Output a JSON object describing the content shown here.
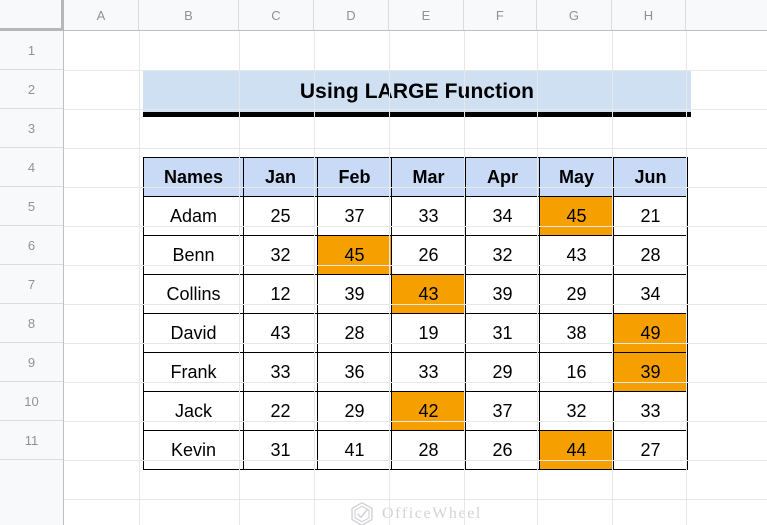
{
  "spreadsheet": {
    "column_headers": [
      "A",
      "B",
      "C",
      "D",
      "E",
      "F",
      "G",
      "H"
    ],
    "row_headers": [
      "1",
      "2",
      "3",
      "4",
      "5",
      "6",
      "7",
      "8",
      "9",
      "10",
      "11"
    ]
  },
  "title": {
    "text": "Using LARGE Function",
    "background_color": "#cfe0f2",
    "underline_color": "#000000"
  },
  "table": {
    "headers": [
      "Names",
      "Jan",
      "Feb",
      "Mar",
      "Apr",
      "May",
      "Jun"
    ],
    "header_background": "#c9daf6",
    "highlight_color": "#f5a000",
    "rows": [
      {
        "name": "Adam",
        "values": [
          "25",
          "37",
          "33",
          "34",
          "45",
          "21"
        ],
        "highlight": 4
      },
      {
        "name": "Benn",
        "values": [
          "32",
          "45",
          "26",
          "32",
          "43",
          "28"
        ],
        "highlight": 1
      },
      {
        "name": "Collins",
        "values": [
          "12",
          "39",
          "43",
          "39",
          "29",
          "34"
        ],
        "highlight": 2
      },
      {
        "name": "David",
        "values": [
          "43",
          "28",
          "19",
          "31",
          "38",
          "49"
        ],
        "highlight": 5
      },
      {
        "name": "Frank",
        "values": [
          "33",
          "36",
          "33",
          "29",
          "16",
          "39"
        ],
        "highlight": 5
      },
      {
        "name": "Jack",
        "values": [
          "22",
          "29",
          "42",
          "37",
          "32",
          "33"
        ],
        "highlight": 2
      },
      {
        "name": "Kevin",
        "values": [
          "31",
          "41",
          "28",
          "26",
          "44",
          "27"
        ],
        "highlight": 4
      }
    ]
  },
  "watermark": {
    "text": "OfficeWheel",
    "icon": "hexagon-check-logo-icon"
  }
}
